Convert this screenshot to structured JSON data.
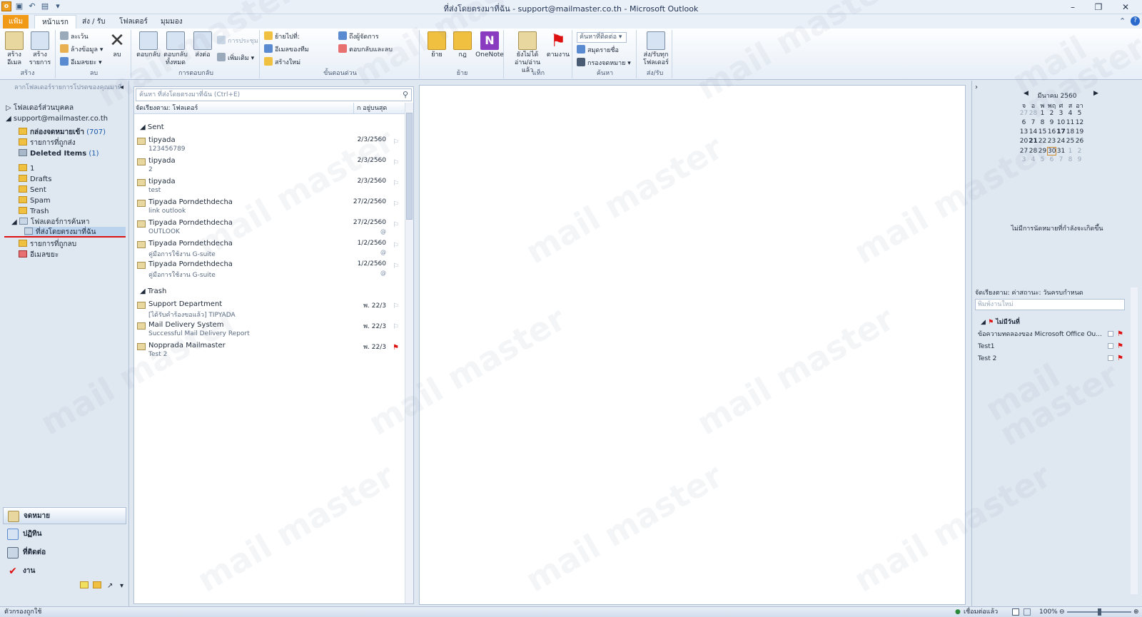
{
  "window": {
    "title": "ที่ส่งโดยตรงมาที่ฉัน - support@mailmaster.co.th - Microsoft Outlook",
    "app_icon": "o",
    "minimize": "–",
    "restore": "❐",
    "close": "✕"
  },
  "tabs": {
    "file": "แฟ้ม",
    "home": "หน้าแรก",
    "send_receive": "ส่ง / รับ",
    "folder": "โฟลเดอร์",
    "view": "มุมมอง"
  },
  "ribbon": {
    "groups": {
      "new": "สร้าง",
      "delete": "ลบ",
      "respond": "การตอบกลับ",
      "quick_steps": "ขั้นตอนด่วน",
      "move": "ย้าย",
      "tags": "แท็ก",
      "find": "ค้นหา",
      "send_receive": "ส่ง/รับ"
    },
    "new_email": "สร้างอีเมล",
    "new_items": "สร้างรายการ",
    "ignore": "ละเว้น",
    "clean_up": "ล้างข้อมูล",
    "junk": "อีเมลขยะ",
    "delete": "ลบ",
    "reply": "ตอบกลับ",
    "reply_all": "ตอบกลับทั้งหมด",
    "forward": "ส่งต่อ",
    "meeting": "การประชุม",
    "more": "เพิ่มเติม",
    "qs_move_to": "ย้ายไปที่:",
    "qs_team_email": "อีเมลของทีม",
    "qs_create_new": "สร้างใหม่",
    "qs_to_manager": "ถึงผู้จัดการ",
    "qs_reply_delete": "ตอบกลับและลบ",
    "move": "ย้าย",
    "rules": "กฎ",
    "onenote": "OneNote",
    "unread_read": "ยังไม่ได้อ่าน/อ่านแล้ว",
    "follow_up": "ตามงาน",
    "find_contact": "ค้นหาที่ติดต่อ",
    "address_book": "สมุดรายชื่อ",
    "filter_email": "กรองจดหมาย",
    "send_receive_all": "ส่ง/รับทุกโฟลเดอร์"
  },
  "nav": {
    "header": "ลากโฟลเดอร์รายการโปรดของคุณมาที่",
    "personal_folders": "โฟลเดอร์ส่วนบุคคล",
    "account": "support@mailmaster.co.th",
    "folders": [
      {
        "name": "กล่องจดหมายเข้า",
        "count": "(707)"
      },
      {
        "name": "รายการที่ถูกส่ง",
        "count": ""
      },
      {
        "name": "Deleted Items",
        "count": "(1)"
      },
      {
        "name": "1",
        "count": ""
      },
      {
        "name": "Drafts",
        "count": ""
      },
      {
        "name": "Sent",
        "count": ""
      },
      {
        "name": "Spam",
        "count": ""
      },
      {
        "name": "Trash",
        "count": ""
      },
      {
        "name": "โฟลเดอร์การค้นหา",
        "count": ""
      },
      {
        "name": "ที่ส่งโดยตรงมาที่ฉัน",
        "count": ""
      },
      {
        "name": "รายการที่ถูกลบ",
        "count": ""
      },
      {
        "name": "อีเมลขยะ",
        "count": ""
      }
    ],
    "modules": {
      "mail": "จดหมาย",
      "calendar": "ปฏิทิน",
      "contacts": "ที่ติดต่อ",
      "tasks": "งาน"
    }
  },
  "list": {
    "search_placeholder": "ค้นหา ที่ส่งโดยตรงมาที่ฉัน (Ctrl+E)",
    "arrange_by": "จัดเรียงตาม: โฟลเดอร์",
    "sort_order": "ก อยู่บนสุด",
    "groups": {
      "sent": "Sent",
      "trash": "Trash"
    },
    "messages": [
      {
        "sender": "tipyada",
        "subject": "123456789",
        "date": "2/3/2560",
        "att": "",
        "flag": "⚐"
      },
      {
        "sender": "tipyada",
        "subject": "2",
        "date": "2/3/2560",
        "att": "",
        "flag": "⚐"
      },
      {
        "sender": "tipyada",
        "subject": "test",
        "date": "2/3/2560",
        "att": "",
        "flag": "⚐"
      },
      {
        "sender": "Tipyada Porndethdecha",
        "subject": "link outlook",
        "date": "27/2/2560",
        "att": "",
        "flag": "⚐"
      },
      {
        "sender": "Tipyada Porndethdecha",
        "subject": "OUTLOOK",
        "date": "27/2/2560",
        "att": "@",
        "flag": "⚐"
      },
      {
        "sender": "Tipyada Porndethdecha",
        "subject": "คู่มือการใช้งาน G-suite",
        "date": "1/2/2560",
        "att": "@",
        "flag": "⚐"
      },
      {
        "sender": "Tipyada Porndethdecha",
        "subject": "คู่มือการใช้งาน G-suite",
        "date": "1/2/2560",
        "att": "@",
        "flag": "⚐"
      },
      {
        "sender": "Support Department",
        "subject": "[ได้รับคำร้องขอแล้ว] TIPYADA",
        "date": "พ. 22/3",
        "att": "",
        "flag": "⚐"
      },
      {
        "sender": "Mail Delivery System",
        "subject": "Successful Mail Delivery Report",
        "date": "พ. 22/3",
        "att": "",
        "flag": "⚐"
      },
      {
        "sender": "Nopprada Mailmaster",
        "subject": "Test 2",
        "date": "พ. 22/3",
        "att": "",
        "flag": "⚑"
      }
    ]
  },
  "todo": {
    "month": "มีนาคม 2560",
    "weekdays": [
      "จ",
      "อ",
      "พ",
      "พฤ",
      "ศ",
      "ส",
      "อา"
    ],
    "weeks": [
      [
        "27",
        "28",
        "1",
        "2",
        "3",
        "4",
        "5"
      ],
      [
        "6",
        "7",
        "8",
        "9",
        "10",
        "11",
        "12"
      ],
      [
        "13",
        "14",
        "15",
        "16",
        "17",
        "18",
        "19"
      ],
      [
        "20",
        "21",
        "22",
        "23",
        "24",
        "25",
        "26"
      ],
      [
        "27",
        "28",
        "29",
        "30",
        "31",
        "1",
        "2"
      ],
      [
        "3",
        "4",
        "5",
        "6",
        "7",
        "8",
        "9"
      ]
    ],
    "no_appointments": "ไม่มีการนัดหมายที่กำลังจะเกิดขึ้น",
    "task_arrange": "จัดเรียงตาม: ค่าสถานะ: วันครบกำหนด",
    "task_placeholder": "พิมพ์งานใหม่",
    "task_group": "ไม่มีวันที่",
    "tasks": [
      "ข้อความทดลองของ Microsoft Office Ou...",
      "Test1",
      "Test 2"
    ]
  },
  "status": {
    "filter": "ตัวกรองถูกใช้",
    "connection": "เชื่อมต่อแล้ว",
    "zoom": "100%",
    "zoom_level_fraction": 0.5
  },
  "watermark": {
    "text": "mail master"
  },
  "colors": {
    "accent": "#f09a18",
    "flag_red": "#dd1111",
    "selection": "#bcd3ee"
  }
}
